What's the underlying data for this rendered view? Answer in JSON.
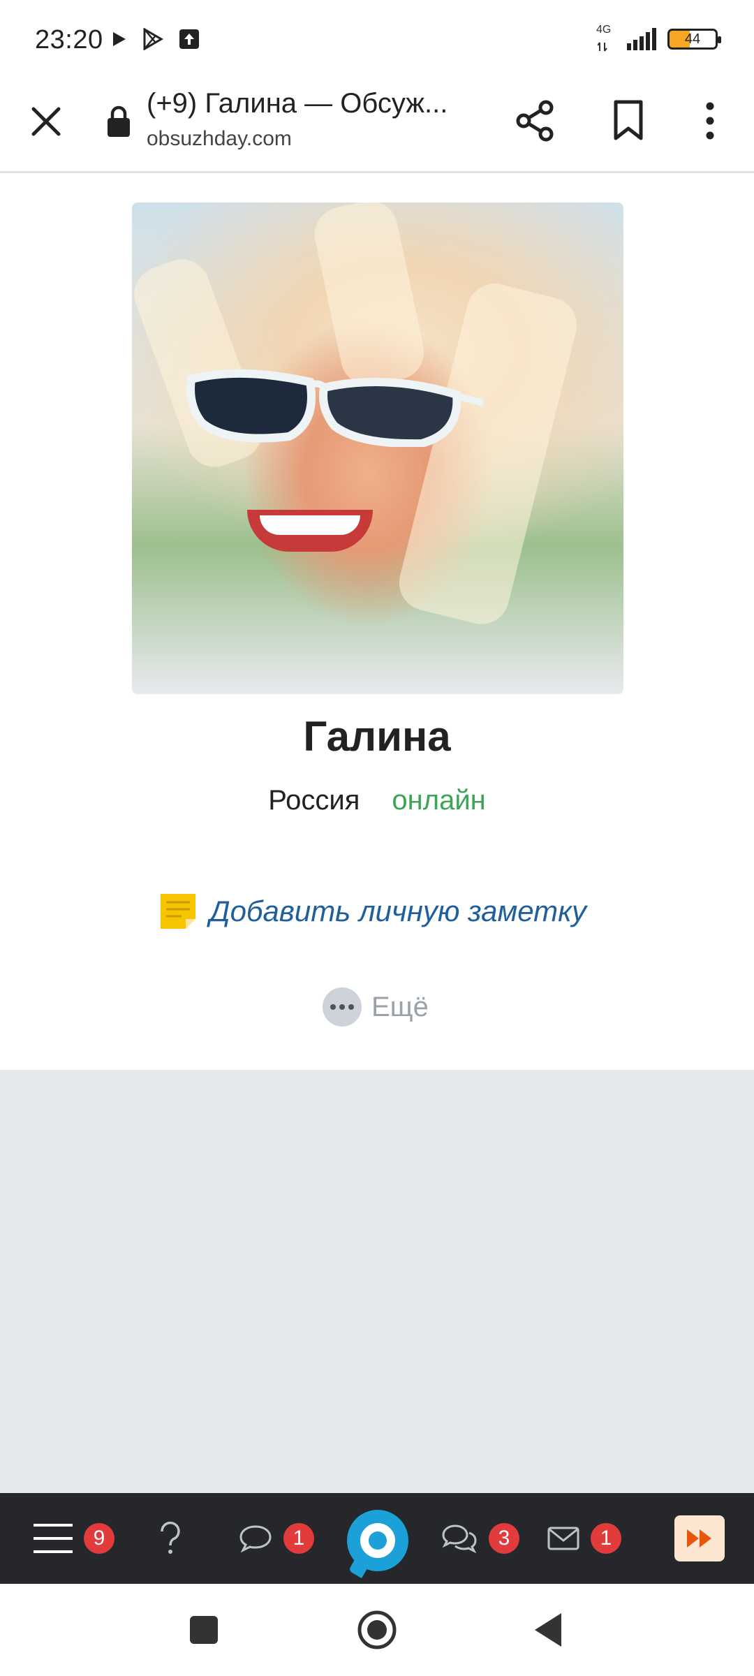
{
  "status_bar": {
    "time": "23:20",
    "network": "4G",
    "battery": "44",
    "icons": [
      "play-arrow-icon",
      "play-store-icon",
      "upload-icon",
      "signal-icon",
      "battery-icon"
    ]
  },
  "browser": {
    "title": "(+9) Галина — Обсуж...",
    "url": "obsuzhday.com",
    "icons": [
      "close-icon",
      "lock-icon",
      "share-icon",
      "bookmark-icon",
      "more-vert-icon"
    ]
  },
  "profile": {
    "name": "Галина",
    "country": "Россия",
    "status": "онлайн",
    "note_link": "Добавить личную заметку",
    "more_label": "Ещё"
  },
  "site_nav": {
    "menu_badge": "9",
    "comments_badge": "1",
    "discussions_badge": "3",
    "messages_badge": "1",
    "icons": [
      "menu-icon",
      "question-icon",
      "comment-icon",
      "site-logo-icon",
      "discussions-icon",
      "mail-icon",
      "fast-forward-icon"
    ]
  },
  "colors": {
    "online": "#3aa655",
    "link": "#1f5f9c",
    "badge": "#e23b3b",
    "nav_bg": "#25272b",
    "logo": "#1ba0d8"
  }
}
